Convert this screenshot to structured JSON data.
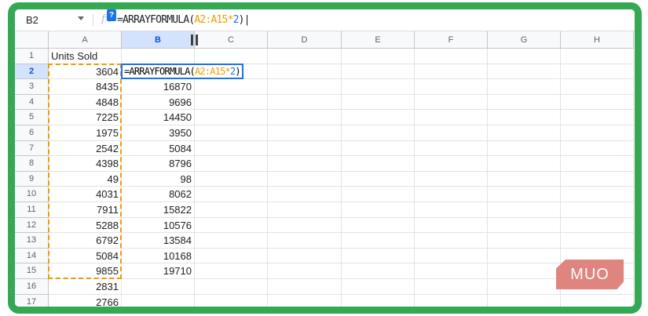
{
  "formula_bar": {
    "name_box": "B2",
    "formula_prefix": "=ARRAYFORMULA(",
    "formula_range": "A2:A15",
    "formula_op": "*",
    "formula_num": "2",
    "formula_suffix": ")",
    "fx_label": "fx",
    "help_label": "?"
  },
  "columns": [
    "A",
    "B",
    "C",
    "D",
    "E",
    "F",
    "G",
    "H"
  ],
  "rows": [
    {
      "n": "1",
      "a": "Units Sold",
      "b": ""
    },
    {
      "n": "2",
      "a": "3604",
      "b": ""
    },
    {
      "n": "3",
      "a": "8435",
      "b": "16870"
    },
    {
      "n": "4",
      "a": "4848",
      "b": "9696"
    },
    {
      "n": "5",
      "a": "7225",
      "b": "14450"
    },
    {
      "n": "6",
      "a": "1975",
      "b": "3950"
    },
    {
      "n": "7",
      "a": "2542",
      "b": "5084"
    },
    {
      "n": "8",
      "a": "4398",
      "b": "8796"
    },
    {
      "n": "9",
      "a": "49",
      "b": "98"
    },
    {
      "n": "10",
      "a": "4031",
      "b": "8062"
    },
    {
      "n": "11",
      "a": "7911",
      "b": "15822"
    },
    {
      "n": "12",
      "a": "5288",
      "b": "10576"
    },
    {
      "n": "13",
      "a": "6792",
      "b": "13584"
    },
    {
      "n": "14",
      "a": "5084",
      "b": "10168"
    },
    {
      "n": "15",
      "a": "9855",
      "b": "19710"
    },
    {
      "n": "16",
      "a": "2831",
      "b": ""
    },
    {
      "n": "17",
      "a": "2766",
      "b": ""
    }
  ],
  "logo": "MUO",
  "colors": {
    "frame": "#34a853",
    "range": "#f29900",
    "accent": "#1a73e8"
  }
}
